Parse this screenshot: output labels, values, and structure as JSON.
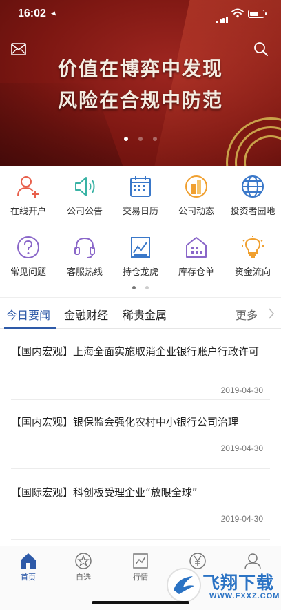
{
  "status_bar": {
    "time": "16:02"
  },
  "banner": {
    "line1": "价值在博弈中发现",
    "line2": "风险在合规中防范",
    "dots": 3,
    "active_dot": 0
  },
  "quick_menu": {
    "row1": [
      {
        "label": "在线开户",
        "icon": "user-add-icon",
        "color": "#e8604c"
      },
      {
        "label": "公司公告",
        "icon": "speaker-icon",
        "color": "#3ab3a5"
      },
      {
        "label": "交易日历",
        "icon": "calendar-icon",
        "color": "#3a78c9"
      },
      {
        "label": "公司动态",
        "icon": "buildings-icon",
        "color": "#f0a030"
      },
      {
        "label": "投资者园地",
        "icon": "globe-icon",
        "color": "#3a78c9"
      }
    ],
    "row2": [
      {
        "label": "常见问题",
        "icon": "question-icon",
        "color": "#8a67c9"
      },
      {
        "label": "客服热线",
        "icon": "headset-icon",
        "color": "#8a67c9"
      },
      {
        "label": "持仓龙虎",
        "icon": "chart-icon",
        "color": "#3a78c9"
      },
      {
        "label": "库存仓单",
        "icon": "warehouse-icon",
        "color": "#8a67c9"
      },
      {
        "label": "资金流向",
        "icon": "lightbulb-icon",
        "color": "#f0a030"
      }
    ],
    "pages": 2,
    "active_page": 0
  },
  "tabs": {
    "items": [
      "今日要闻",
      "金融财经",
      "稀贵金属"
    ],
    "active": 0,
    "more": "更多"
  },
  "news": [
    {
      "title": "【国内宏观】上海全面实施取消企业银行账户行政许可",
      "date": "2019-04-30"
    },
    {
      "title": "【国内宏观】银保监会强化农村中小银行公司治理",
      "date": "2019-04-30"
    },
    {
      "title": "【国际宏观】科创板受理企业“放眼全球”",
      "date": "2019-04-30"
    }
  ],
  "bottom_nav": [
    {
      "label": "首页",
      "icon": "home-icon"
    },
    {
      "label": "自选",
      "icon": "star-icon"
    },
    {
      "label": "行情",
      "icon": "market-icon"
    },
    {
      "label": "",
      "icon": "yen-icon"
    },
    {
      "label": "",
      "icon": "profile-icon"
    }
  ],
  "watermark": {
    "text": "飞翔下载",
    "url": "WWW.FXXZ.COM"
  },
  "colors": {
    "accent": "#2e5aa8",
    "banner": "#8b1d17"
  }
}
